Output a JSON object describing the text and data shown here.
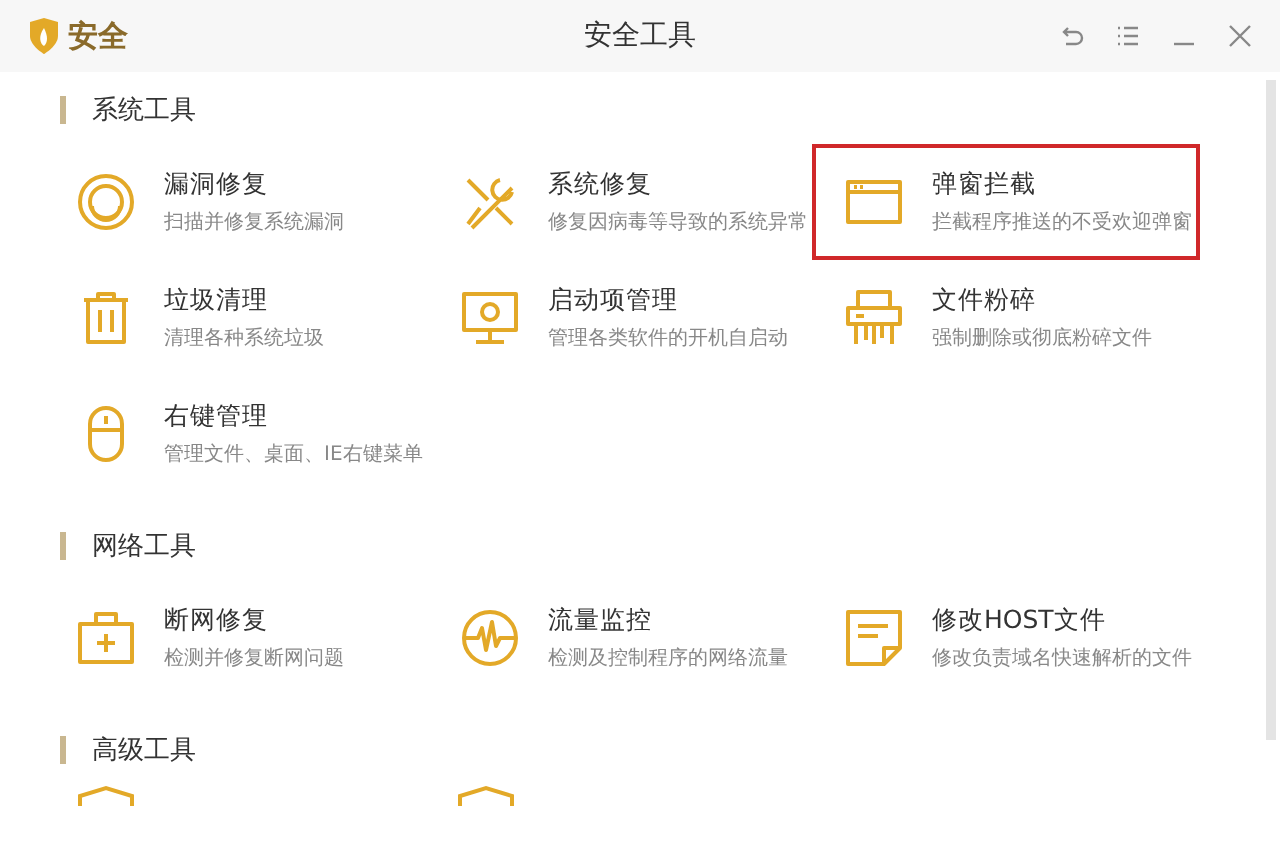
{
  "window": {
    "logo_text": "安全",
    "title": "安全工具"
  },
  "sections": [
    {
      "title": "系统工具",
      "items": [
        {
          "name": "漏洞修复",
          "desc": "扫描并修复系统漏洞",
          "selected": false
        },
        {
          "name": "系统修复",
          "desc": "修复因病毒等导致的系统异常",
          "selected": false
        },
        {
          "name": "弹窗拦截",
          "desc": "拦截程序推送的不受欢迎弹窗",
          "selected": true
        },
        {
          "name": "垃圾清理",
          "desc": "清理各种系统垃圾",
          "selected": false
        },
        {
          "name": "启动项管理",
          "desc": "管理各类软件的开机自启动",
          "selected": false
        },
        {
          "name": "文件粉碎",
          "desc": "强制删除或彻底粉碎文件",
          "selected": false
        },
        {
          "name": "右键管理",
          "desc": "管理文件、桌面、IE右键菜单",
          "selected": false
        }
      ]
    },
    {
      "title": "网络工具",
      "items": [
        {
          "name": "断网修复",
          "desc": "检测并修复断网问题",
          "selected": false
        },
        {
          "name": "流量监控",
          "desc": "检测及控制程序的网络流量",
          "selected": false
        },
        {
          "name": "修改HOST文件",
          "desc": "修改负责域名快速解析的文件",
          "selected": false
        }
      ]
    },
    {
      "title": "高级工具"
    }
  ]
}
